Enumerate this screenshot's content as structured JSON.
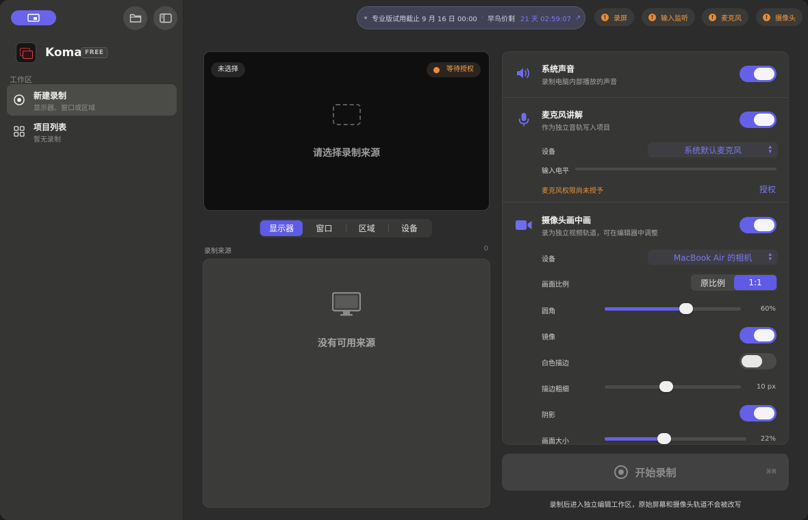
{
  "sidebar": {
    "app_name": "Koma",
    "badge": "FREE",
    "section_label": "工作区",
    "items": [
      {
        "title": "新建录制",
        "subtitle": "显示器、窗口或区域"
      },
      {
        "title": "项目列表",
        "subtitle": "暂无录制"
      }
    ]
  },
  "topbar": {
    "trial_text": "专业版试用截止 9 月 16 日 00:00",
    "sep": "·",
    "early_price": "早鸟价剩",
    "countdown": "21 天 02:59:07",
    "arrow": "↗",
    "permissions": [
      "录屏",
      "输入监听",
      "麦克风",
      "摄像头"
    ],
    "warn_glyph": "!"
  },
  "preview": {
    "unselected": "未选择",
    "awaiting": "等待授权",
    "prompt": "请选择录制来源"
  },
  "tabs": [
    "显示器",
    "窗口",
    "区域",
    "设备"
  ],
  "sources": {
    "label": "录制来源",
    "count": "0",
    "empty": "没有可用来源"
  },
  "panel": {
    "system_audio": {
      "title": "系统声音",
      "subtitle": "录制电脑内部播放的声音"
    },
    "mic": {
      "title": "麦克风讲解",
      "subtitle": "作为独立音轨写入项目",
      "device_label": "设备",
      "device_value": "系统默认麦克风",
      "level_label": "输入电平",
      "warning": "麦克风权限尚未授予",
      "auth_link": "授权"
    },
    "camera": {
      "title": "摄像头画中画",
      "subtitle": "录为独立视频轨道，可在编辑器中调整",
      "device_label": "设备",
      "device_value": "MacBook Air 的相机",
      "ratio_label": "画面比例",
      "ratio_options": [
        "原比例",
        "1:1"
      ],
      "corner_label": "圆角",
      "corner_value": "60%",
      "corner_fraction": 0.6,
      "mirror_label": "镜像",
      "border_label": "白色描边",
      "stroke_label": "描边粗细",
      "stroke_value": "10 px",
      "stroke_fraction": 0.45,
      "shadow_label": "阴影",
      "size_label": "画面大小",
      "size_value": "22%",
      "size_fraction": 0.42
    }
  },
  "start": {
    "label": "开始录制",
    "shortcut": "⌘R"
  },
  "footer": "录制后进入独立编辑工作区，原始屏幕和摄像头轨道不会被改写",
  "colors": {
    "accent": "#6461e8",
    "warning": "#eb8f37"
  }
}
